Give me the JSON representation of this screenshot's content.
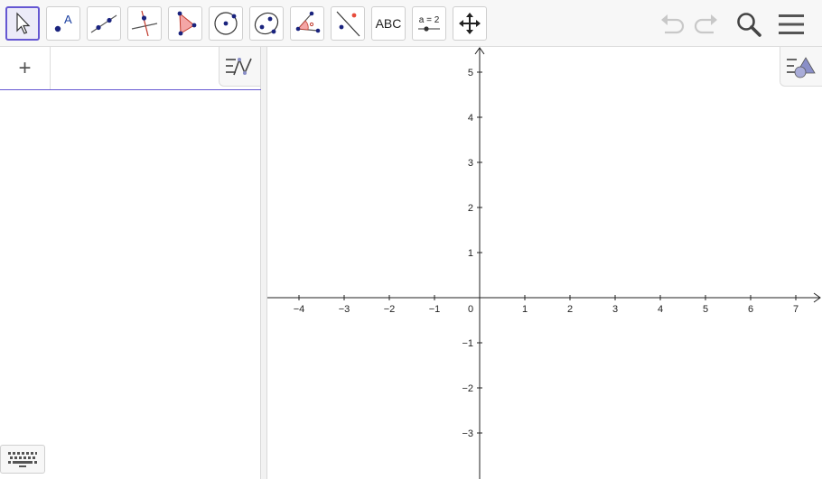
{
  "toolbar": {
    "tools": [
      {
        "name": "move-tool",
        "icon": "arrow-cursor-icon",
        "selected": true
      },
      {
        "name": "point-tool",
        "icon": "point-icon"
      },
      {
        "name": "line-tool",
        "icon": "line-through-points-icon"
      },
      {
        "name": "perpendicular-line-tool",
        "icon": "perpendicular-line-icon"
      },
      {
        "name": "polygon-tool",
        "icon": "polygon-icon"
      },
      {
        "name": "circle-tool",
        "icon": "circle-center-point-icon"
      },
      {
        "name": "ellipse-tool",
        "icon": "ellipse-icon"
      },
      {
        "name": "angle-tool",
        "icon": "angle-icon"
      },
      {
        "name": "reflect-tool",
        "icon": "reflect-about-line-icon"
      },
      {
        "name": "text-tool",
        "icon": "text-icon",
        "label": "ABC"
      },
      {
        "name": "slider-tool",
        "icon": "slider-icon",
        "label": "a = 2"
      },
      {
        "name": "move-graphics-tool",
        "icon": "move-graphics-view-icon"
      }
    ],
    "undo_icon": "undo-icon",
    "redo_icon": "redo-icon",
    "search_icon": "search-icon",
    "menu_icon": "hamburger-menu-icon"
  },
  "algebra": {
    "add_label": "+",
    "style_icon": "algebra-style-bar-icon"
  },
  "graphics": {
    "style_icon": "graphics-style-bar-icon",
    "x_ticks": [
      "−4",
      "−3",
      "−2",
      "−1",
      "0",
      "1",
      "2",
      "3",
      "4",
      "5",
      "6",
      "7"
    ],
    "y_ticks_pos": [
      "1",
      "2",
      "3",
      "4",
      "5"
    ],
    "y_ticks_neg": [
      "−1",
      "−2",
      "−3"
    ]
  },
  "keyboard": {
    "icon": "keyboard-icon"
  },
  "colors": {
    "accent": "#6557d2",
    "toolbar_bg": "#f7f7f7"
  }
}
